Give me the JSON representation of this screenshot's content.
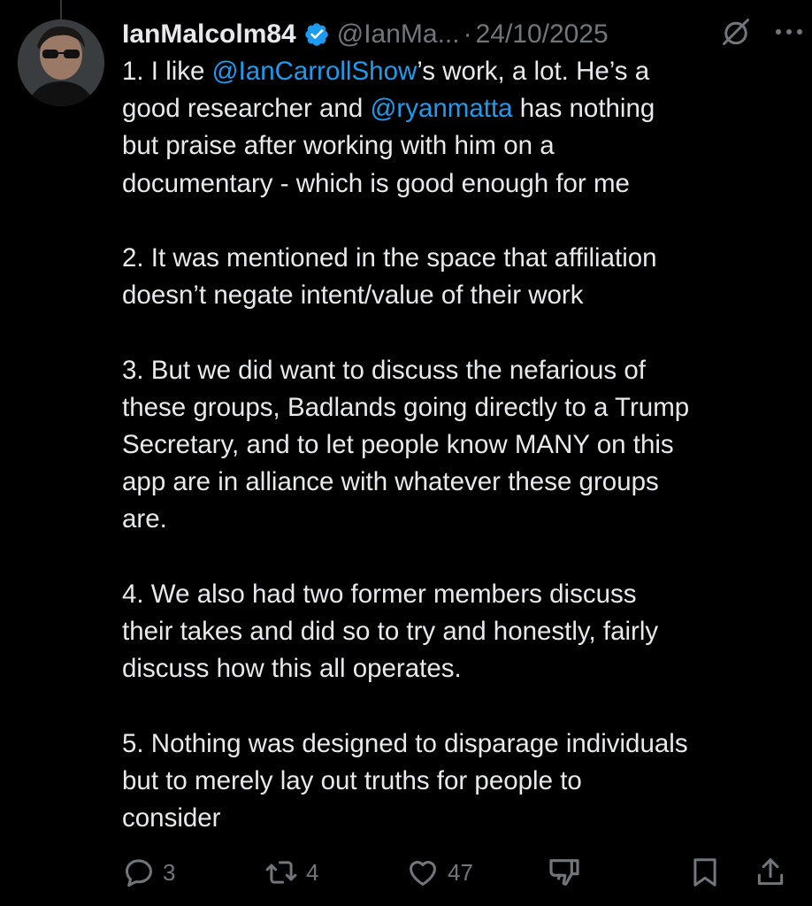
{
  "tweet": {
    "display_name": "IanMalcolm84",
    "handle": "@IanMa...",
    "separator": "·",
    "date": "24/10/2025",
    "paragraphs": [
      {
        "prefix": "1. I like ",
        "mention1": "@IanCarrollShow",
        "mid": "’s work, a lot. He’s a\ngood researcher and ",
        "mention2": "@ryanmatta",
        "suffix": " has nothing\nbut praise after working with him on a\ndocumentary - which is good enough for me"
      },
      {
        "text": "2. It was mentioned in the space that affiliation\ndoesn’t negate intent/value of their work"
      },
      {
        "text": "3. But we did want to discuss the nefarious of\nthese groups, Badlands going directly to a Trump\nSecretary, and to let people know MANY on this\napp are in alliance with whatever these groups\nare."
      },
      {
        "text": "4. We also had two former members discuss\ntheir takes and did so to try and honestly, fairly\ndiscuss how this all operates."
      },
      {
        "text": "5. Nothing was designed to disparage individuals\nbut to merely lay out truths for people to\nconsider"
      }
    ]
  },
  "actions": {
    "replies": "3",
    "reposts": "4",
    "likes": "47"
  },
  "colors": {
    "background": "#000000",
    "text": "#e7e9ea",
    "muted": "#71767b",
    "accent": "#1d9bf0"
  },
  "icons": [
    "verified-badge-icon",
    "grok-icon",
    "more-icon",
    "reply-icon",
    "repost-icon",
    "like-icon",
    "dislike-icon",
    "bookmark-icon",
    "share-icon"
  ]
}
